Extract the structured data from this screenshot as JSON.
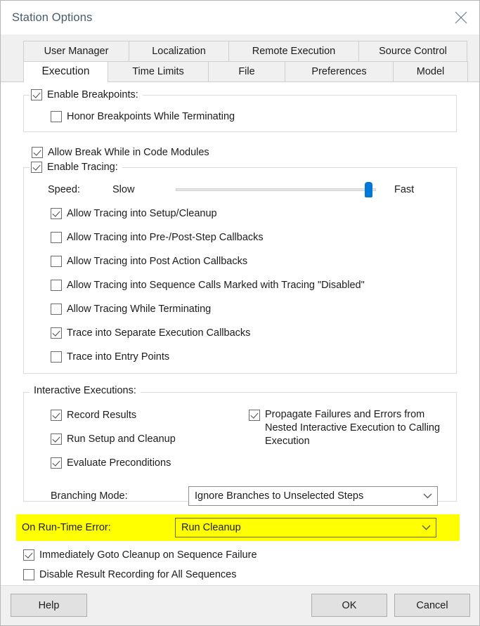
{
  "window": {
    "title": "Station Options",
    "close_icon": "close-icon"
  },
  "tabs": {
    "row1": [
      {
        "label": "User Manager",
        "active": false
      },
      {
        "label": "Localization",
        "active": false
      },
      {
        "label": "Remote Execution",
        "active": false
      },
      {
        "label": "Source Control",
        "active": false
      }
    ],
    "row2": [
      {
        "label": "Execution",
        "active": true
      },
      {
        "label": "Time Limits",
        "active": false
      },
      {
        "label": "File",
        "active": false
      },
      {
        "label": "Preferences",
        "active": false
      },
      {
        "label": "Model",
        "active": false
      }
    ]
  },
  "breakpoints": {
    "group_label": "Enable Breakpoints:",
    "group_checked": true,
    "honor_label": "Honor Breakpoints While Terminating",
    "honor_checked": false
  },
  "allow_break": {
    "label": "Allow Break While in Code Modules",
    "checked": true
  },
  "tracing": {
    "group_label": "Enable Tracing:",
    "group_checked": true,
    "speed_label": "Speed:",
    "slow_label": "Slow",
    "fast_label": "Fast",
    "slider_percent": 96,
    "options": [
      {
        "label": "Allow Tracing into Setup/Cleanup",
        "checked": true
      },
      {
        "label": "Allow Tracing into Pre-/Post-Step Callbacks",
        "checked": false
      },
      {
        "label": "Allow Tracing into Post Action Callbacks",
        "checked": false
      },
      {
        "label": "Allow Tracing into Sequence Calls Marked with Tracing \"Disabled\"",
        "checked": false
      },
      {
        "label": "Allow Tracing While Terminating",
        "checked": false
      },
      {
        "label": "Trace into Separate Execution Callbacks",
        "checked": true
      },
      {
        "label": "Trace into Entry Points",
        "checked": false
      }
    ]
  },
  "interactive": {
    "group_label": "Interactive Executions:",
    "left_options": [
      {
        "label": "Record Results",
        "checked": true
      },
      {
        "label": "Run Setup and Cleanup",
        "checked": true
      },
      {
        "label": "Evaluate Preconditions",
        "checked": true
      }
    ],
    "propagate": {
      "label": "Propagate Failures and Errors from Nested Interactive Execution to Calling Execution",
      "checked": true
    },
    "branching_label": "Branching Mode:",
    "branching_value": "Ignore Branches to Unselected Steps"
  },
  "runtime_error": {
    "label": "On Run-Time Error:",
    "value": "Run Cleanup",
    "highlight_color": "#ffff00"
  },
  "bottom_options": [
    {
      "label": "Immediately Goto Cleanup on Sequence Failure",
      "checked": true
    },
    {
      "label": "Disable Result Recording for All Sequences",
      "checked": false
    }
  ],
  "footer": {
    "help_label": "Help",
    "ok_label": "OK",
    "cancel_label": "Cancel"
  }
}
